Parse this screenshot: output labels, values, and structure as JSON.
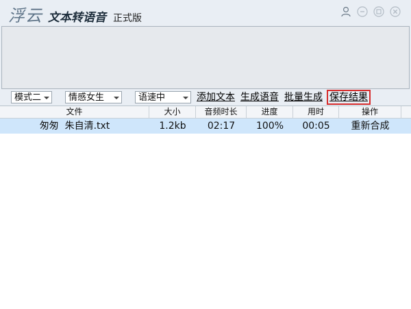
{
  "window": {
    "logo": "浮云",
    "title": "文本转语音",
    "edition": "正式版"
  },
  "titlebar_icons": [
    "user-icon",
    "minimize-icon",
    "maximize-icon",
    "close-icon"
  ],
  "toolbar": {
    "mode_select": "模式二",
    "voice_select": "情感女生",
    "speed_select": "语速中",
    "add_text": "添加文本",
    "generate_speech": "生成语音",
    "batch_generate": "批量生成",
    "save_result": "保存结果"
  },
  "table": {
    "headers": [
      "文件",
      "大小",
      "音频时长",
      "进度",
      "用时",
      "操作"
    ],
    "rows": [
      {
        "file": "匆匆  朱自清.txt",
        "size": "1.2kb",
        "duration": "02:17",
        "progress": "100%",
        "elapsed": "00:05",
        "action": "重新合成"
      }
    ]
  },
  "colors": {
    "selected_row": "#cfe6fb",
    "highlight_border": "#d62b2b",
    "window_bg": "#e9eef4"
  }
}
